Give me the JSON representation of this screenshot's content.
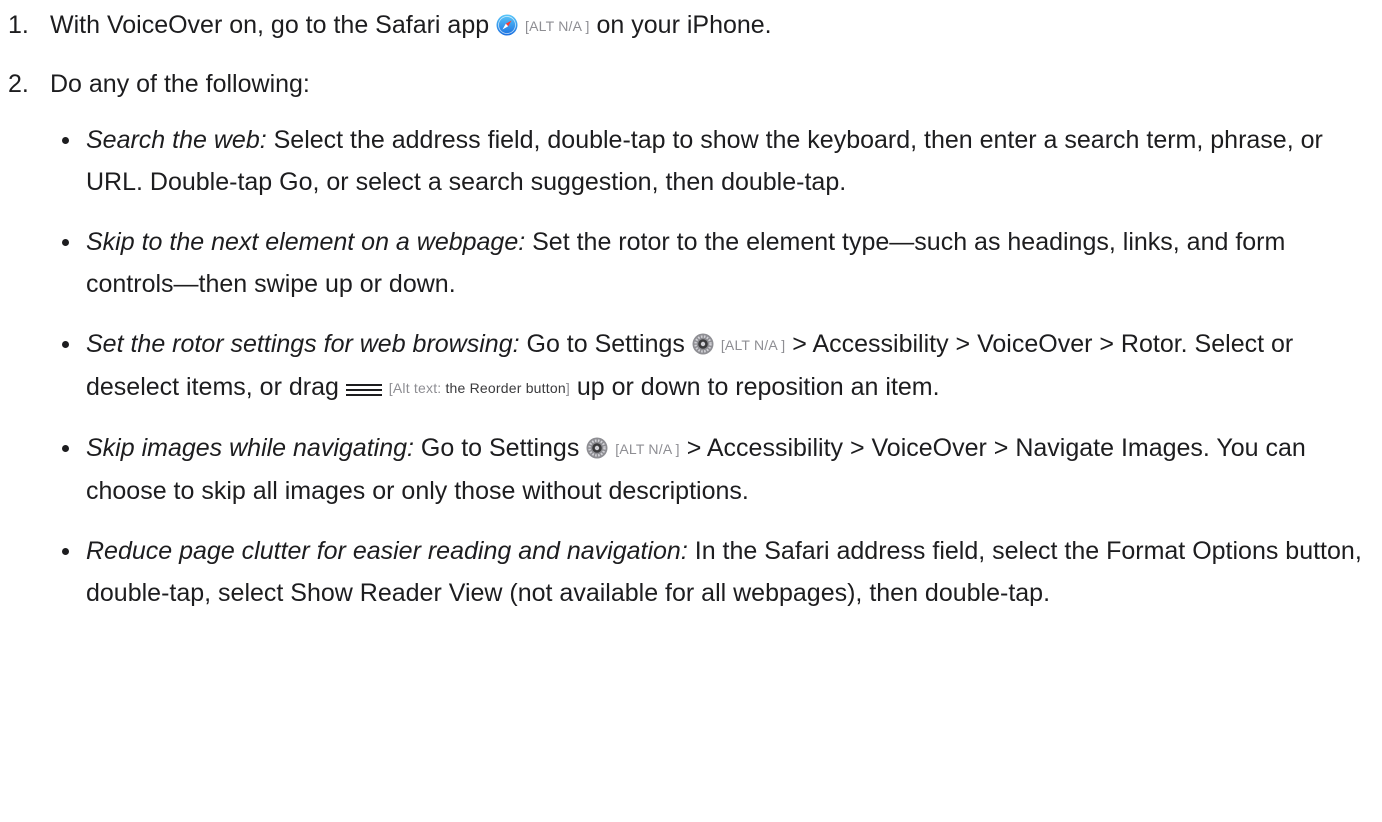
{
  "steps": [
    {
      "number": "1.",
      "before_icon": "With VoiceOver on, go to the Safari app ",
      "icon": "safari-icon",
      "alt": "[ALT N/A ]",
      "after_icon": " on your iPhone."
    },
    {
      "number": "2.",
      "text": "Do any of the following:"
    }
  ],
  "bullets": {
    "search": {
      "term": "Search the web:",
      "text": " Select the address field, double-tap to show the keyboard, then enter a search term, phrase, or URL. Double-tap Go, or select a search suggestion, then double-tap."
    },
    "skip_element": {
      "term": "Skip to the next element on a webpage:",
      "text": " Set the rotor to the element type—such as headings, links, and form controls—then swipe up or down."
    },
    "rotor": {
      "term": "Set the rotor settings for web browsing:",
      "text_1": " Go to Settings ",
      "icon_1": "settings-gear-icon",
      "alt_1": "[ALT N/A ]",
      "text_2": "  > Accessibility > VoiceOver > Rotor. Select or deselect items, or drag ",
      "icon_2": "reorder-icon",
      "alt_2_prefix": "[Alt text: ",
      "alt_2_desc": "the Reorder button",
      "alt_2_suffix": "]",
      "text_3": " up or down to reposition an item."
    },
    "images": {
      "term": "Skip images while navigating:",
      "text_1": " Go to Settings ",
      "icon_1": "settings-gear-icon",
      "alt_1": "[ALT N/A ]",
      "text_2": " > Accessibility > VoiceOver > Navigate Images. You can choose to skip all images or only those without descriptions."
    },
    "clutter": {
      "term": "Reduce page clutter for easier reading and navigation:",
      "text": " In the Safari address field, select the Format Options button, double-tap, select Show Reader View (not available for all webpages), then double-tap."
    }
  },
  "colors": {
    "text": "#1d1d1f",
    "alt_text": "#8e8e93",
    "safari_blue": "#1a8cff",
    "settings_gray": "#8e8e93"
  }
}
